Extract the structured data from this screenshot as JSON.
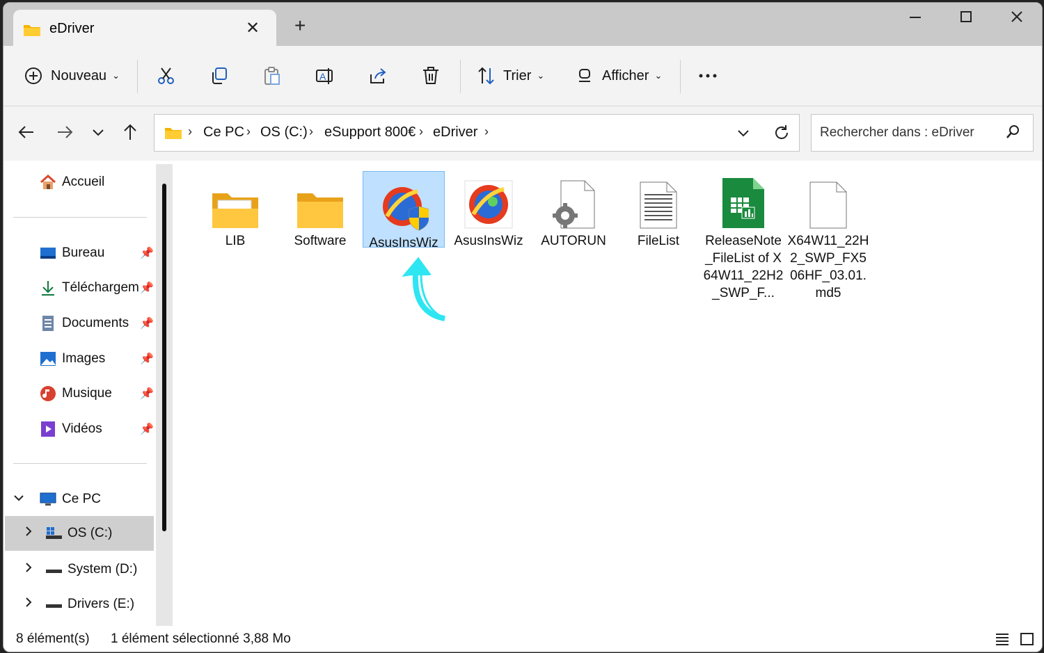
{
  "window": {
    "tab_title": "eDriver"
  },
  "toolbar": {
    "new_label": "Nouveau",
    "sort_label": "Trier",
    "view_label": "Afficher"
  },
  "address": {
    "crumbs": [
      "Ce PC",
      "OS (C:)",
      "eSupport 800€",
      "eDriver"
    ]
  },
  "search": {
    "placeholder": "Rechercher dans : eDriver"
  },
  "sidebar": {
    "home": "Accueil",
    "quick": [
      "Bureau",
      "Téléchargem",
      "Documents",
      "Images",
      "Musique",
      "Vidéos"
    ],
    "thispc": "Ce PC",
    "drives": [
      "OS (C:)",
      "System (D:)",
      "Drivers (E:)"
    ]
  },
  "files": [
    {
      "name": "LIB",
      "icon": "folder-doc-icon"
    },
    {
      "name": "Software",
      "icon": "folder-icon"
    },
    {
      "name": "AsusInsWiz",
      "icon": "asus-installer-shield-icon",
      "selected": true
    },
    {
      "name": "AsusInsWiz",
      "icon": "asus-installer-icon"
    },
    {
      "name": "AUTORUN",
      "icon": "settings-file-icon"
    },
    {
      "name": "FileList",
      "icon": "text-file-icon"
    },
    {
      "name": "ReleaseNote_FileList of X64W11_22H2_SWP_F...",
      "icon": "spreadsheet-icon"
    },
    {
      "name": "X64W11_22H2_SWP_FX506HF_03.01.md5",
      "icon": "blank-file-icon"
    }
  ],
  "status": {
    "count": "8 élément(s)",
    "selection": "1 élément sélectionné  3,88 Mo"
  },
  "colors": {
    "selection_bg": "#bfe0ff",
    "accent": "#0067c0",
    "arrow": "#2de6f2"
  }
}
